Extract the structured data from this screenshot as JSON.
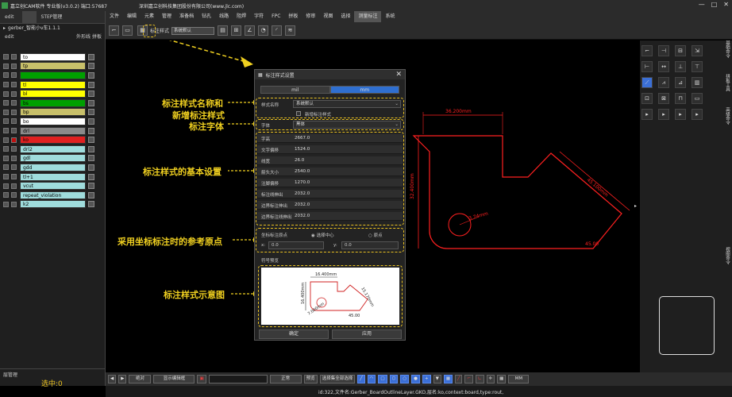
{
  "titlebar": {
    "title": "嘉立创CAM软件 专业版(v3.0.2) 端口:57687",
    "company": "深圳嘉立创科技集团股份有限公司(www.jlc.com)",
    "min": "—",
    "max": "□",
    "close": "✕"
  },
  "left_panel": {
    "tab1": "edit",
    "tab2": "STEP管理",
    "file": "gerber_智能小v车1.1.1",
    "sub_left": "edit",
    "sub_right1": "外形线",
    "sub_right2": "拼板",
    "layers": [
      {
        "name": "to",
        "color": "#ffffff"
      },
      {
        "name": "tp",
        "color": "#c8c06a"
      },
      {
        "name": "",
        "color": "#00a000"
      },
      {
        "name": "tl",
        "color": "#ffff00"
      },
      {
        "name": "bl",
        "color": "#ffff00"
      },
      {
        "name": "bs",
        "color": "#00a000"
      },
      {
        "name": "bp",
        "color": "#c8c06a"
      },
      {
        "name": "bo",
        "color": "#ffffff"
      },
      {
        "name": "drl",
        "color": "#8a8a8a"
      },
      {
        "name": "ko",
        "color": "#e02020"
      },
      {
        "name": "drl2",
        "color": "#9fdcdc"
      },
      {
        "name": "gdl",
        "color": "#9fdcdc"
      },
      {
        "name": "gdd",
        "color": "#9fdcdc"
      },
      {
        "name": "tl+1",
        "color": "#9fdcdc"
      },
      {
        "name": "vcut",
        "color": "#9fdcdc"
      },
      {
        "name": "repeat_violation",
        "color": "#9fdcdc"
      },
      {
        "name": "k2",
        "color": "#9fdcdc"
      }
    ],
    "footer_mgr": "层管理",
    "selected": "选中:0"
  },
  "menu": [
    "文件",
    "编辑",
    "元素",
    "管理",
    "准备档",
    "钻孔",
    "线路",
    "阻焊",
    "字符",
    "FPC",
    "拼板",
    "修审",
    "视图",
    "选择",
    "测量标注",
    "系统"
  ],
  "menu_active": "测量标注",
  "toolbar": {
    "label": "标注样式",
    "select": "系统默认"
  },
  "dialog": {
    "title": "标注样式设置",
    "unit_mil": "mil",
    "unit_mm": "mm",
    "style_name_label": "样式名称",
    "style_name_value": "系统默认",
    "new_style_label": "新增标注样式",
    "font_label": "字体",
    "font_value": "黑体",
    "params": [
      {
        "label": "字高",
        "value": "2667.0"
      },
      {
        "label": "文字偏移",
        "value": "1524.0"
      },
      {
        "label": "线宽",
        "value": "26.0"
      },
      {
        "label": "箭头大小",
        "value": "2540.0"
      },
      {
        "label": "注脚偏移",
        "value": "1270.0"
      },
      {
        "label": "标注线伸出",
        "value": "2032.0"
      },
      {
        "label": "边界标注伸出",
        "value": "2032.0"
      },
      {
        "label": "边界标注线伸出",
        "value": "2032.0"
      }
    ],
    "origin_label": "坐标标注原点",
    "origin_opt1": "选择中心",
    "origin_opt2": "原点",
    "x_label": "x:",
    "x_value": "0.0",
    "y_label": "y:",
    "y_value": "0.0",
    "preview_label": "符号预览",
    "ok": "确定",
    "apply": "应用",
    "preview_dims": {
      "top": "16.400mm",
      "left": "16.400mm",
      "diag": "15.170mm",
      "bottom": "45.00",
      "small": "7.000mm"
    }
  },
  "annotations": [
    "标注样式名称和",
    "新增标注样式",
    "标注字体",
    "标注样式的基本设置",
    "采用坐标标注时的参考原点",
    "标注样式示意图"
  ],
  "canvas_dims": {
    "top": "36.200mm",
    "left": "32.400mm",
    "diag": "45.100mm",
    "circle": "3.74mm",
    "bottom": "45.00"
  },
  "rightpanel": {
    "vtab1": "基础命令",
    "vtab2": "拼板工具",
    "vtab3": "高级命令",
    "vtab4": "视图命令"
  },
  "bottombar": {
    "pos_select": "绝对",
    "ctrl1": "显示编辑框",
    "mode_select": "正常",
    "prop": "预览",
    "cmd": "选择集全部选择",
    "unit": "MM"
  },
  "status": "id:322,文件名:Gerber_BoardOutlineLayer.GKO,层名:ko,context:board,type:rout,",
  "colors": {
    "accent": "#2f6fd0",
    "annotation": "#f0d020",
    "outline": "#e02020"
  }
}
